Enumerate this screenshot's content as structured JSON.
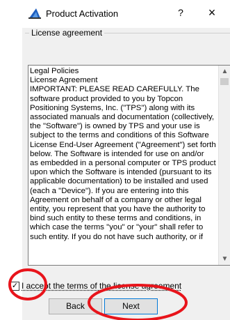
{
  "window": {
    "title": "Product Activation",
    "help_label": "?",
    "close_label": "×"
  },
  "group": {
    "label": "License agreement"
  },
  "license": {
    "lines": [
      "Legal Policies",
      "License Agreement",
      "IMPORTANT:  PLEASE READ CAREFULLY.  The",
      "software product provided to you  by Topcon",
      "Positioning Systems, Inc. (\"TPS\") along with its",
      "associated manuals and documentation (collectively,",
      "the \"Software\") is owned by TPS and your use is",
      "subject to the terms and conditions of this Software",
      "License End-User Agreement (\"Agreement\") set forth",
      "below. The Software is intended for use on and/or",
      "as embedded in a personal computer or TPS product",
      "upon which the Software is intended (pursuant to its",
      "applicable documentation) to be installed and used",
      "(each a \"Device\"). If you are entering into this",
      "Agreement on behalf of a company or other legal",
      "entity, you represent that you have the authority to",
      "bind such entity to these terms and conditions, in",
      "which case the terms \"you\" or \"your\" shall refer to",
      "such entity. If you do not have such authority, or if"
    ]
  },
  "accept": {
    "label": "I accept the terms of the license agreement",
    "checked": true
  },
  "buttons": {
    "back": "Back",
    "next": "Next"
  },
  "colors": {
    "annotation": "#e8141b",
    "accent": "#0078d7"
  },
  "icons": {
    "title": "product-activation-icon",
    "scroll_up": "▲",
    "scroll_down": "▼",
    "check": "✓"
  }
}
